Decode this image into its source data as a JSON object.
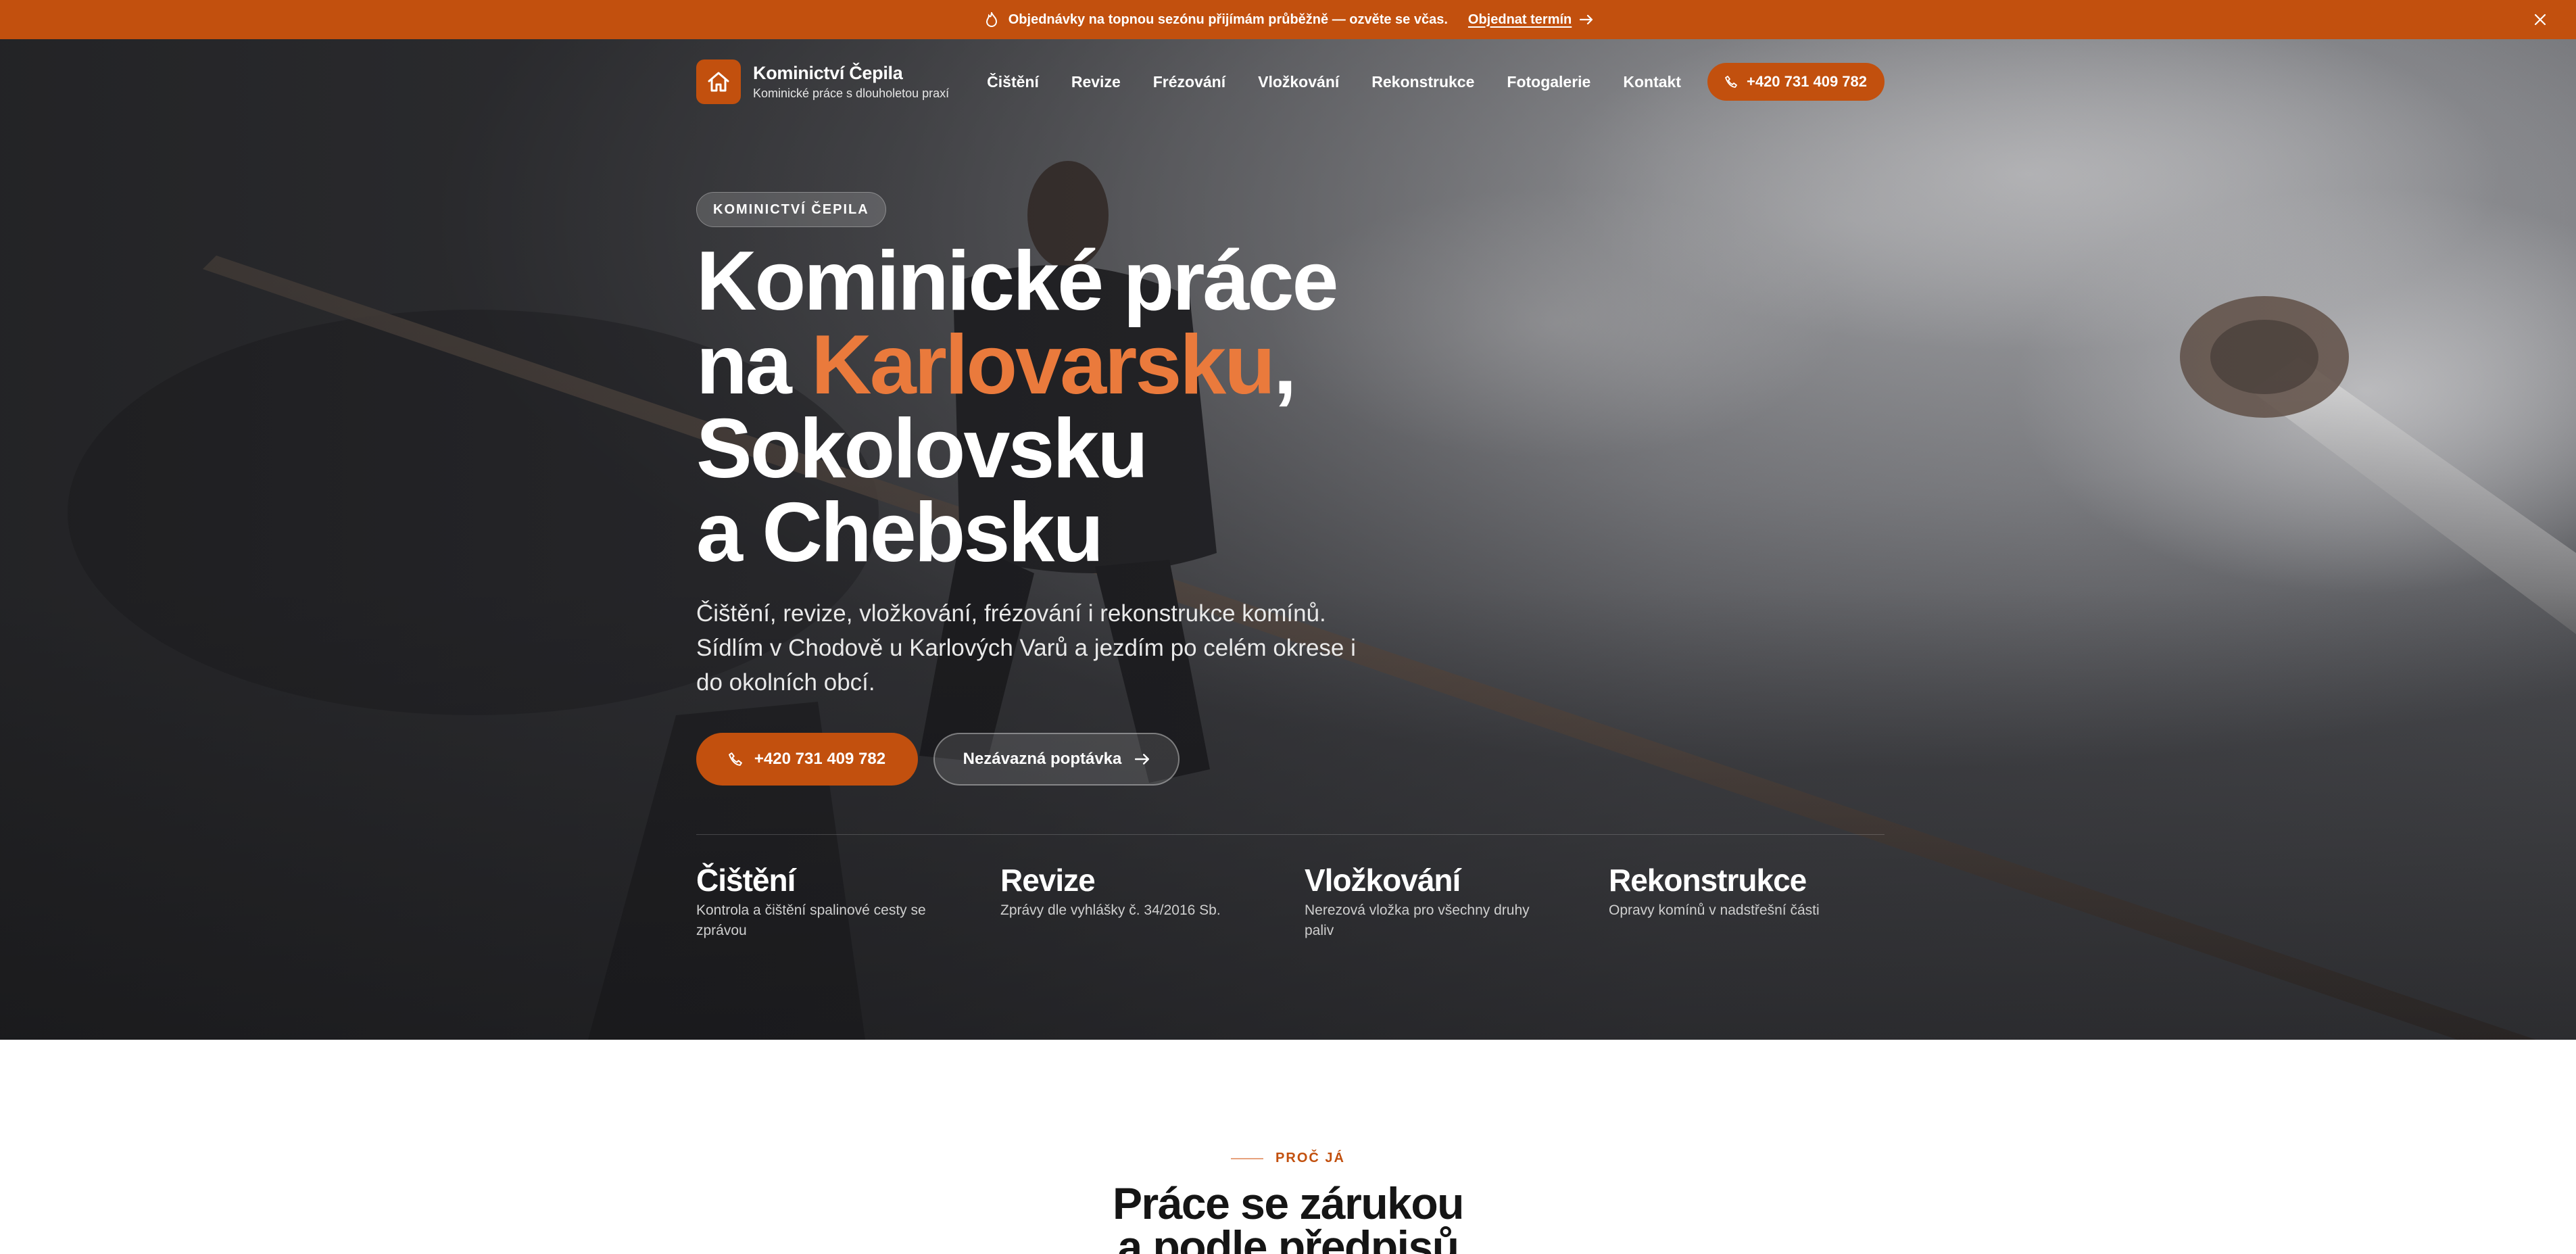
{
  "announcement": {
    "icon": "flame-icon",
    "message": "Objednávky na topnou sezónu přijímám průběžně — ozvěte se včas.",
    "cta_label": "Objednat termín",
    "close_icon": "close-icon"
  },
  "brand": {
    "name": "Kominictví Čepila",
    "tagline": "Kominické práce s dlouholetou praxí",
    "icon": "house-icon",
    "accent_color": "#c2500e"
  },
  "nav": {
    "items": [
      {
        "label": "Čištění"
      },
      {
        "label": "Revize"
      },
      {
        "label": "Frézování"
      },
      {
        "label": "Vložkování"
      },
      {
        "label": "Rekonstrukce"
      },
      {
        "label": "Fotogalerie"
      },
      {
        "label": "Kontakt"
      }
    ],
    "phone_label": "+420 731 409 782"
  },
  "hero": {
    "badge": "KOMINICTVÍ ČEPILA",
    "headline_line1": "Kominické práce",
    "headline_na": "na ",
    "headline_highlight": "Karlovarsku",
    "headline_comma": ",",
    "headline_line3": "Sokolovsku",
    "headline_line4": "a Chebsku",
    "highlight_color": "#ea7a3c",
    "lead": "Čištění, revize, vložkování, frézování i rekonstrukce komínů. Sídlím v Chodově u Karlových Varů a jezdím po celém okrese i do okolních obcí.",
    "primary_button": "+420 731 409 782",
    "secondary_button": "Nezávazná poptávka"
  },
  "services": [
    {
      "title": "Čištění",
      "desc": "Kontrola a čištění spalinové cesty se zprávou"
    },
    {
      "title": "Revize",
      "desc": "Zprávy dle vyhlášky č. 34/2016 Sb."
    },
    {
      "title": "Vložkování",
      "desc": "Nerezová vložka pro všechny druhy paliv"
    },
    {
      "title": "Rekonstrukce",
      "desc": "Opravy komínů v nadstřešní části"
    }
  ],
  "why": {
    "kicker": "PROČ JÁ",
    "title_line1": "Práce se zárukou",
    "title_line2": "a podle předpisů"
  }
}
